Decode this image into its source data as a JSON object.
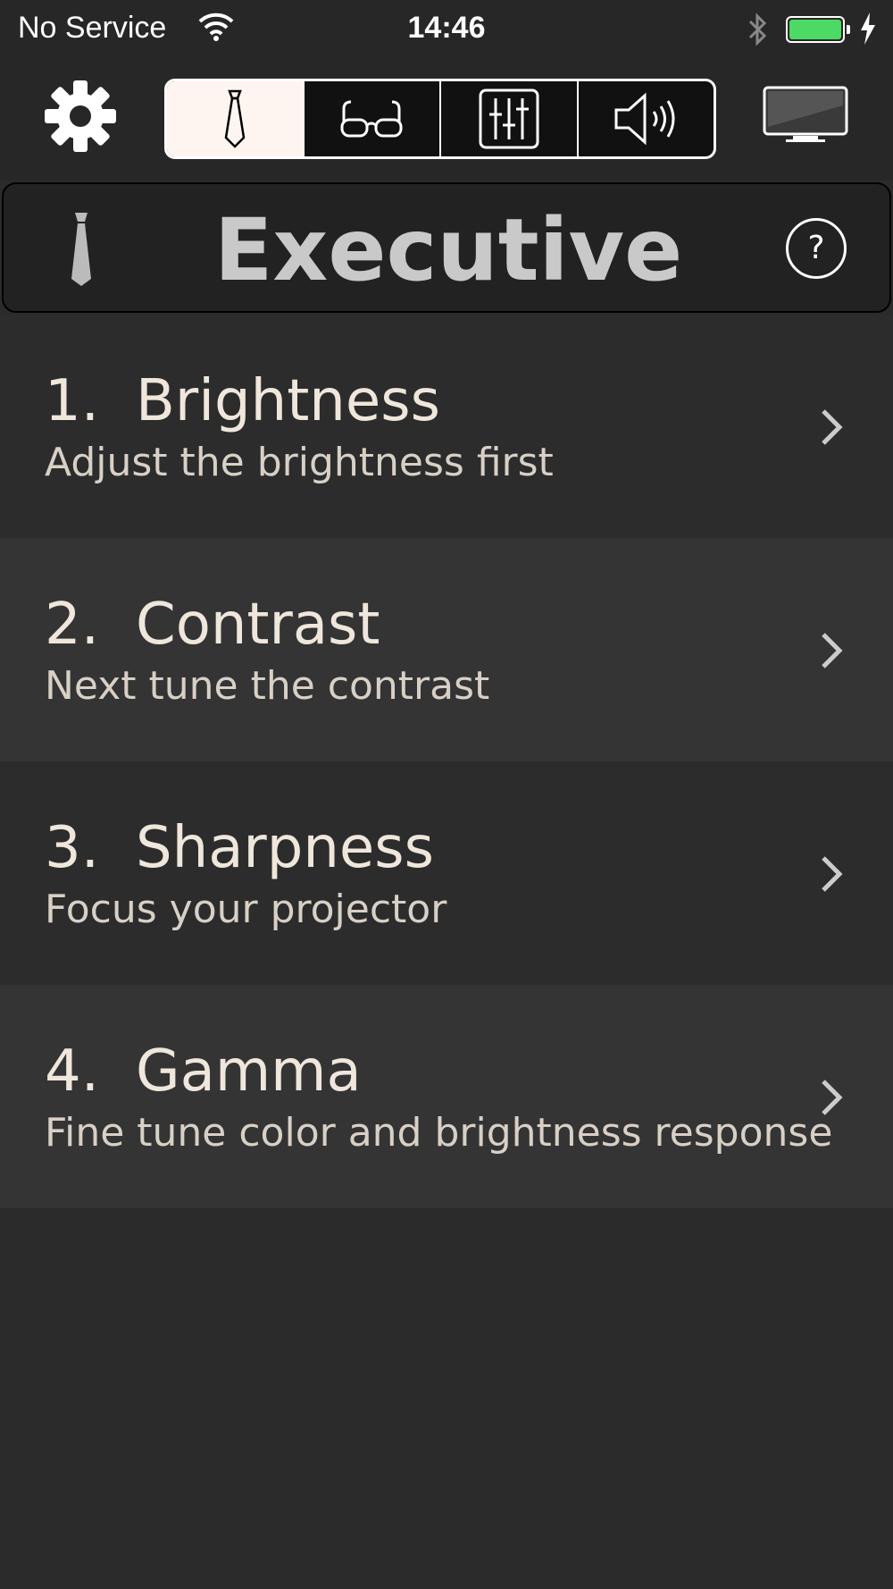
{
  "status_bar": {
    "carrier": "No Service",
    "time": "14:46",
    "battery_level": 1.0,
    "battery_color": "#4cd964"
  },
  "toolbar": {
    "settings_icon": "gear-icon",
    "segments": [
      {
        "icon": "tie-icon",
        "selected": true
      },
      {
        "icon": "glasses-icon",
        "selected": false
      },
      {
        "icon": "sliders-icon",
        "selected": false
      },
      {
        "icon": "speaker-icon",
        "selected": false
      }
    ],
    "display_icon": "monitor-icon"
  },
  "header": {
    "title": "Executive",
    "help_label": "?"
  },
  "steps": [
    {
      "number": "1.",
      "name": "Brightness",
      "description": "Adjust the brightness first"
    },
    {
      "number": "2.",
      "name": "Contrast",
      "description": "Next tune the contrast"
    },
    {
      "number": "3.",
      "name": "Sharpness",
      "description": "Focus your projector"
    },
    {
      "number": "4.",
      "name": "Gamma",
      "description": "Fine tune color and brightness response"
    }
  ]
}
